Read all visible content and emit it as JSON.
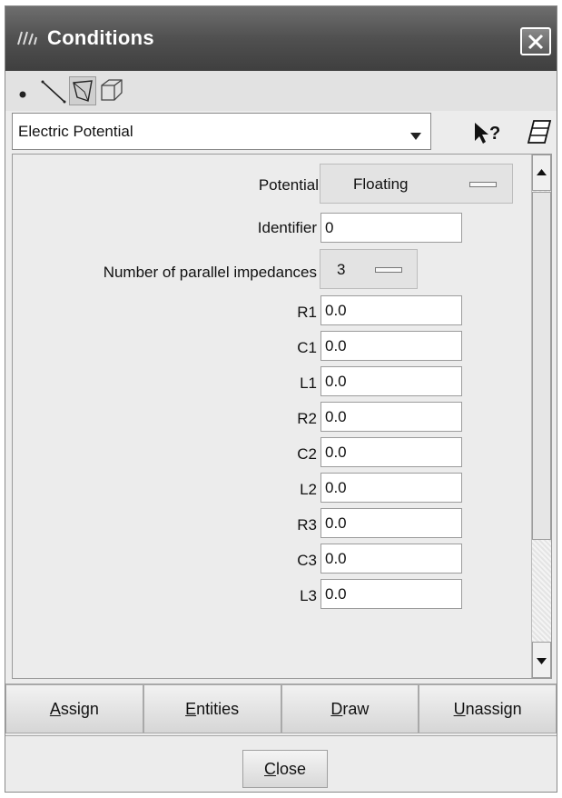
{
  "window": {
    "title": "Conditions",
    "close_glyph": "✕"
  },
  "entity_toolbar": {
    "items": [
      {
        "icon": "point-icon"
      },
      {
        "icon": "line-icon"
      },
      {
        "icon": "surface-icon",
        "selected": true
      },
      {
        "icon": "volume-icon"
      }
    ]
  },
  "condition_select": {
    "value": "Electric Potential"
  },
  "fields": {
    "potential": {
      "label": "Potential",
      "value": "Floating"
    },
    "identifier": {
      "label": "Identifier",
      "value": "0"
    },
    "parallel": {
      "label": "Number of parallel impedances",
      "value": "3"
    },
    "impedances": [
      {
        "label": "R1",
        "value": "0.0"
      },
      {
        "label": "C1",
        "value": "0.0"
      },
      {
        "label": "L1",
        "value": "0.0"
      },
      {
        "label": "R2",
        "value": "0.0"
      },
      {
        "label": "C2",
        "value": "0.0"
      },
      {
        "label": "L2",
        "value": "0.0"
      },
      {
        "label": "R3",
        "value": "0.0"
      },
      {
        "label": "C3",
        "value": "0.0"
      },
      {
        "label": "L3",
        "value": "0.0"
      }
    ]
  },
  "actions": {
    "assign": "Assign",
    "entities": "Entities",
    "draw": "Draw",
    "unassign": "Unassign"
  },
  "close_label": "Close",
  "colors": {
    "titlebar": "#505050",
    "panel": "#ececec"
  }
}
